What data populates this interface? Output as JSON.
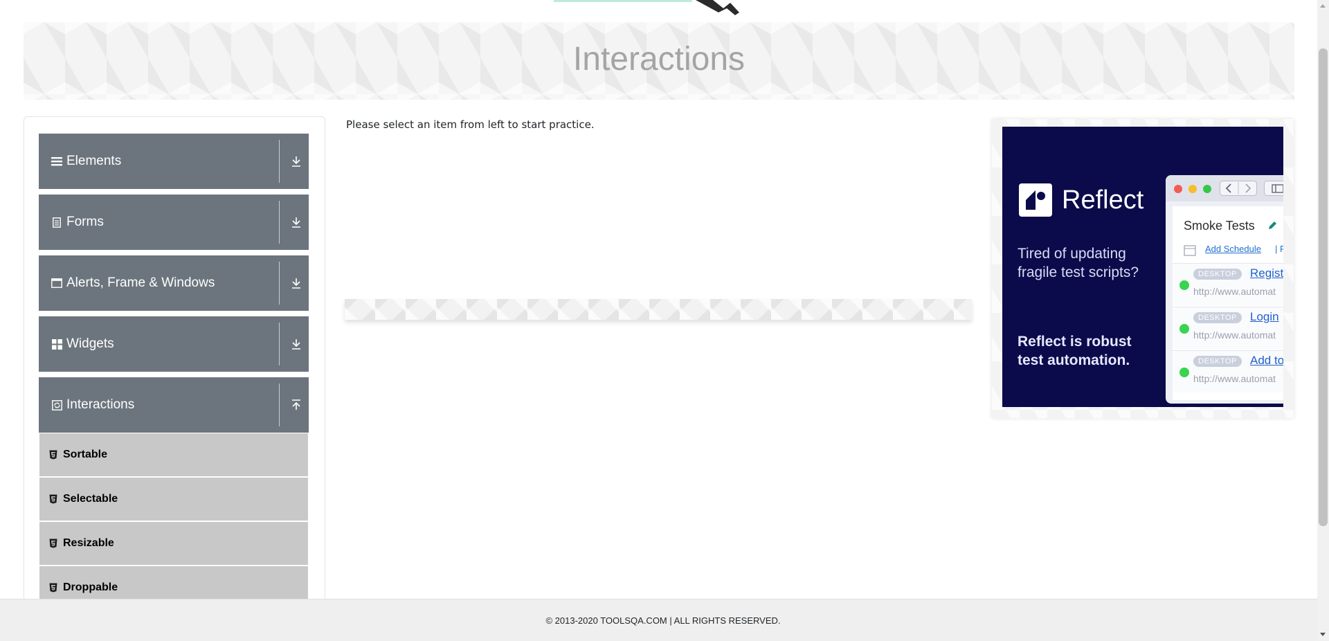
{
  "header": {
    "title": "Interactions"
  },
  "sidebar": {
    "groups": [
      {
        "label": "Elements",
        "icon": "menu-icon",
        "expanded": false
      },
      {
        "label": "Forms",
        "icon": "document-icon",
        "expanded": false
      },
      {
        "label": "Alerts, Frame & Windows",
        "icon": "window-icon",
        "expanded": false
      },
      {
        "label": "Widgets",
        "icon": "grid-icon",
        "expanded": false
      },
      {
        "label": "Interactions",
        "icon": "refresh-icon",
        "expanded": true
      }
    ],
    "items": [
      {
        "label": "Sortable"
      },
      {
        "label": "Selectable"
      },
      {
        "label": "Resizable"
      },
      {
        "label": "Droppable"
      }
    ]
  },
  "main": {
    "message": "Please select an item from left to start practice."
  },
  "ad": {
    "brand": "Reflect",
    "tagline": "Tired of updating fragile test scripts?",
    "claim": "Reflect is robust test automation.",
    "suite_title": "Smoke Tests",
    "schedule_link": "Add Schedule",
    "schedule_sep": "| Ru",
    "runs": [
      {
        "badge": "DESKTOP",
        "name": "Registr",
        "url": "http://www.automat"
      },
      {
        "badge": "DESKTOP",
        "name": "Login",
        "url": "http://www.automat"
      },
      {
        "badge": "DESKTOP",
        "name": "Add to",
        "url": "http://www.automat"
      }
    ],
    "colors": {
      "background": "#0b0a4a",
      "status_ok": "#38d44f"
    }
  },
  "footer": {
    "copyright": "© 2013-2020 TOOLSQA.COM | ALL RIGHTS RESERVED."
  },
  "colors": {
    "group_header": "#6c757d",
    "menu_item": "#c8c8c8",
    "title": "#a4a4a4"
  }
}
